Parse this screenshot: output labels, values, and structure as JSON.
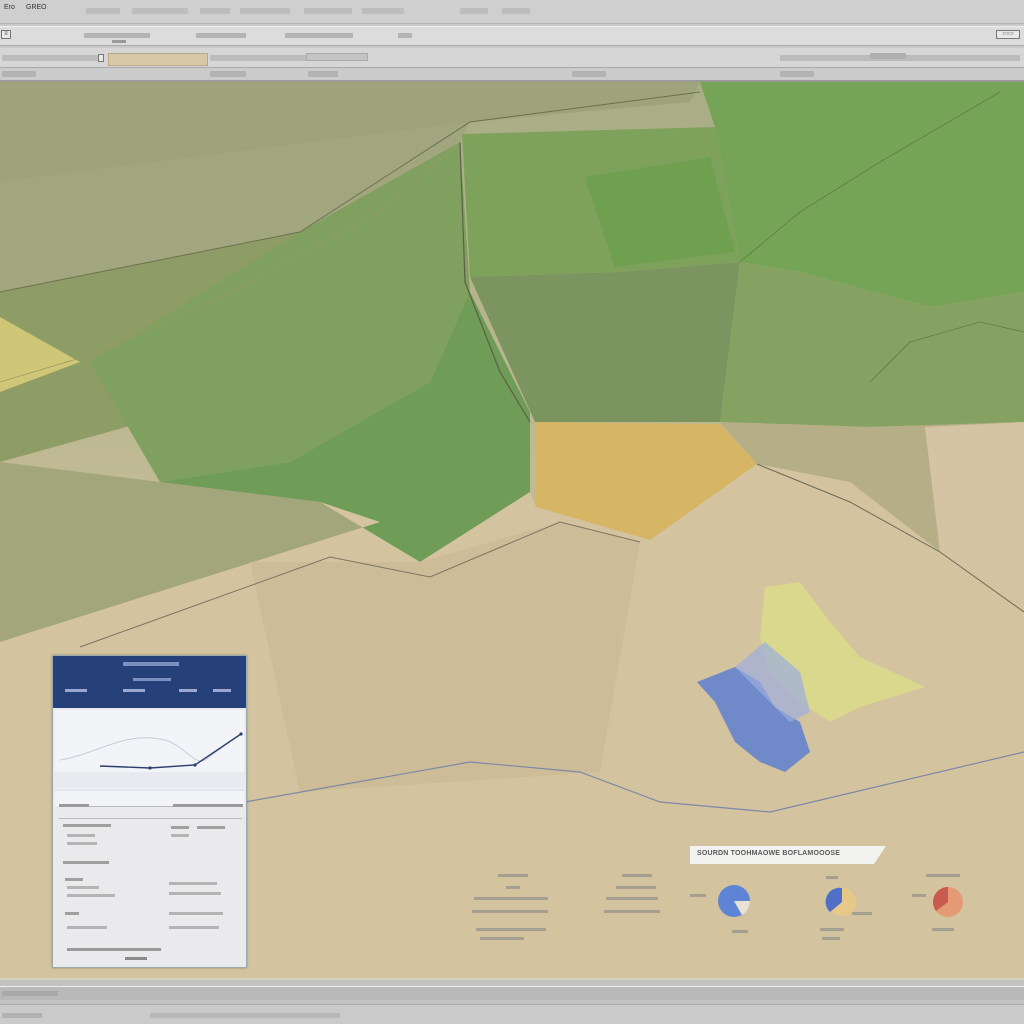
{
  "menubar": {
    "items": [
      "Ero",
      "GREO"
    ]
  },
  "legend": {
    "title": "SOURDN TOOHMAOWE BOFLAMOOOSE"
  },
  "colors": {
    "inset_header": "#26407a",
    "field_green": "#6e9a58",
    "field_yellow": "#d7b25a",
    "water_blue": "#5c7fd2",
    "marsh_yellow": "#d8d78a",
    "background_tan": "#d6c6a6"
  },
  "icons": [
    "app-icon",
    "layer-icon",
    "search-icon"
  ]
}
